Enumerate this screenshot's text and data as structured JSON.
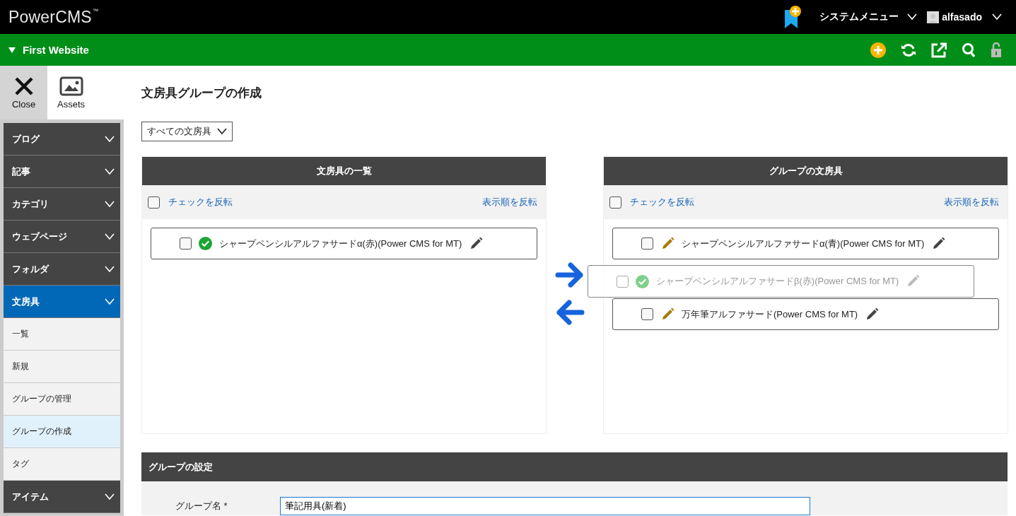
{
  "header": {
    "logo": "PowerCMS",
    "logo_mark": "™",
    "system_menu": "システムメニュー",
    "user": "alfasado"
  },
  "site_bar": {
    "site_name": "First Website"
  },
  "sidebar": {
    "tabs": [
      {
        "kind": "close",
        "label": "Close",
        "selected": true
      },
      {
        "kind": "assets",
        "label": "Assets",
        "selected": false
      }
    ],
    "menu": [
      {
        "label": "ブログ",
        "selected": false
      },
      {
        "label": "記事",
        "selected": false
      },
      {
        "label": "カテゴリ",
        "selected": false
      },
      {
        "label": "ウェブページ",
        "selected": false
      },
      {
        "label": "フォルダ",
        "selected": false
      },
      {
        "label": "文房具",
        "selected": true,
        "children": [
          {
            "label": "一覧",
            "selected": false
          },
          {
            "label": "新規",
            "selected": false
          },
          {
            "label": "グループの管理",
            "selected": false
          },
          {
            "label": "グループの作成",
            "selected": true
          },
          {
            "label": "タグ",
            "selected": false
          }
        ]
      },
      {
        "label": "アイテム",
        "selected": false
      }
    ]
  },
  "page_title": "文房具グループの作成",
  "filter": {
    "value": "すべての文房具"
  },
  "panels": [
    {
      "title": "文房具の一覧",
      "select_all_checked": false,
      "invert_check": "チェックを反転",
      "reverse_order": "表示順を反転",
      "items": [
        {
          "kind": "published",
          "label": "シャープペンシルアルファサードα(赤)(Power CMS for MT)",
          "checked": false
        }
      ]
    },
    {
      "title": "グループの文房具",
      "select_all_checked": false,
      "invert_check": "チェックを反転",
      "reverse_order": "表示順を反転",
      "items": [
        {
          "kind": "draft",
          "label": "シャープペンシルアルファサードα(青)(Power CMS for MT)",
          "checked": false
        },
        {
          "kind": "draft",
          "label": "万年筆アルファサード(Power CMS for MT)",
          "checked": false
        }
      ]
    }
  ],
  "dragged_item": {
    "kind": "published",
    "label": "シャープペンシルアルファサードβ(赤)(Power CMS for MT)",
    "checked": false
  },
  "settings": {
    "title": "グループの設定",
    "fields": [
      {
        "label": "グループ名 *",
        "value": "筆記用具(新着)"
      }
    ]
  }
}
